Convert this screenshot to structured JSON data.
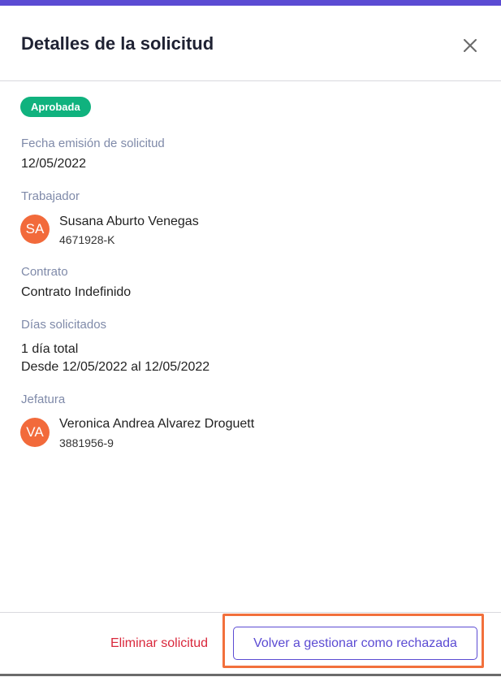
{
  "dialog": {
    "title": "Detalles de la solicitud",
    "close_icon": "close-icon",
    "status_badge": "Aprobada",
    "colors": {
      "accent": "#5b4bd3",
      "approved": "#10b27e",
      "danger": "#d9273b",
      "avatar": "#f26a3b",
      "highlight": "#f2703c"
    }
  },
  "fields": {
    "issue_date": {
      "label": "Fecha emisión de solicitud",
      "value": "12/05/2022"
    },
    "worker": {
      "label": "Trabajador",
      "initials": "SA",
      "name": "Susana Aburto Venegas",
      "id": "4671928-K"
    },
    "contract": {
      "label": "Contrato",
      "value": "Contrato Indefinido"
    },
    "days": {
      "label": "Días solicitados",
      "total": "1 día total",
      "range": "Desde 12/05/2022 al 12/05/2022"
    },
    "manager": {
      "label": "Jefatura",
      "initials": "VA",
      "name": "Veronica Andrea Alvarez Droguett",
      "id": "3881956-9"
    }
  },
  "footer": {
    "delete_label": "Eliminar solicitud",
    "regest_label": "Volver a gestionar como rechazada"
  }
}
